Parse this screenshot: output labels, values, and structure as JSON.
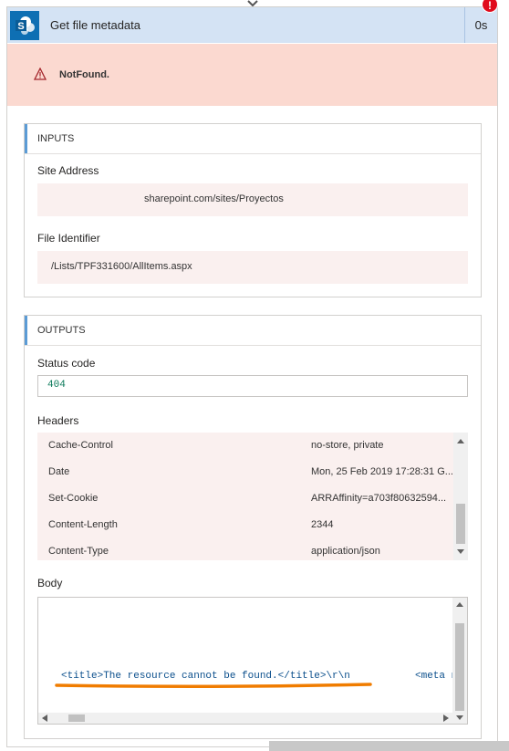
{
  "action": {
    "title": "Get file metadata",
    "duration": "0s",
    "error_badge": "!",
    "connector_icon": "sharepoint-icon"
  },
  "error": {
    "message": "NotFound.",
    "icon": "warning-icon"
  },
  "inputs": {
    "section_title": "INPUTS",
    "site_address_label": "Site Address",
    "site_address_value": "sharepoint.com/sites/Proyectos",
    "file_identifier_label": "File Identifier",
    "file_identifier_value": "/Lists/TPF331600/AllItems.aspx"
  },
  "outputs": {
    "section_title": "OUTPUTS",
    "status_code_label": "Status code",
    "status_code_value": "404",
    "headers_label": "Headers",
    "headers": [
      {
        "key": "Cache-Control",
        "value": "no-store, private"
      },
      {
        "key": "Date",
        "value": "Mon, 25 Feb 2019 17:28:31 G..."
      },
      {
        "key": "Set-Cookie",
        "value": "ARRAffinity=a703f80632594..."
      },
      {
        "key": "Content-Length",
        "value": "2344"
      },
      {
        "key": "Content-Type",
        "value": "application/json"
      }
    ],
    "body_label": "Body",
    "body_text": "<title>The resource cannot be found.</title>\\r\\n",
    "body_text_tail": "<meta n"
  },
  "colors": {
    "header_bg": "#d4e3f4",
    "error_bg": "#fbd9d0",
    "error_badge": "#e00b1c",
    "sharepoint_blue": "#0e6fb3",
    "highlight_underline": "#f07c00"
  }
}
